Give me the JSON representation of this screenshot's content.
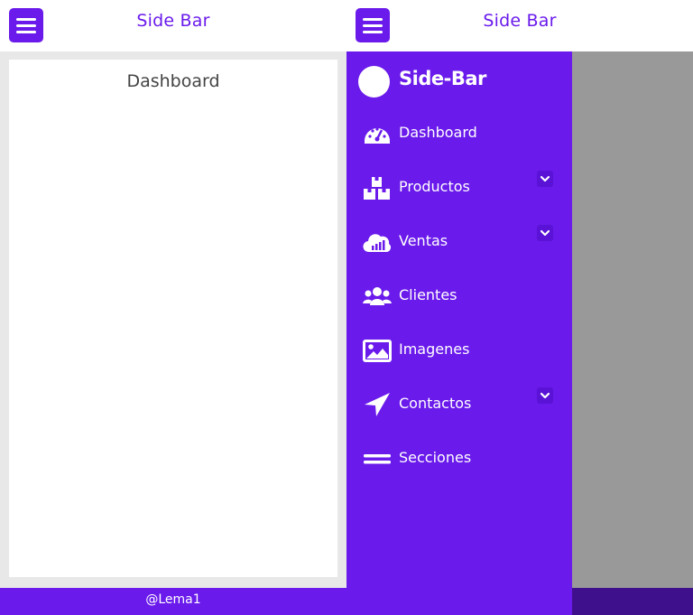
{
  "header": {
    "title": "Side Bar"
  },
  "main": {
    "card_title": "Dashboard"
  },
  "footer": {
    "text": "@Lema1"
  },
  "sidebar": {
    "title": "Side-Bar",
    "items": [
      {
        "label": "Dashboard",
        "icon": "dashboard-gauge-icon",
        "has_submenu": false
      },
      {
        "label": "Productos",
        "icon": "boxes-icon",
        "has_submenu": true
      },
      {
        "label": "Ventas",
        "icon": "cloud-chart-icon",
        "has_submenu": true
      },
      {
        "label": "Clientes",
        "icon": "users-icon",
        "has_submenu": false
      },
      {
        "label": "Imagenes",
        "icon": "image-icon",
        "has_submenu": false
      },
      {
        "label": "Contactos",
        "icon": "paper-plane-icon",
        "has_submenu": true
      },
      {
        "label": "Secciones",
        "icon": "equals-icon",
        "has_submenu": false
      }
    ]
  },
  "colors": {
    "accent": "#6a1aeb",
    "chevron_bg": "#5a12d6",
    "overlay": "#999999",
    "footer_dim": "#3f108c"
  }
}
